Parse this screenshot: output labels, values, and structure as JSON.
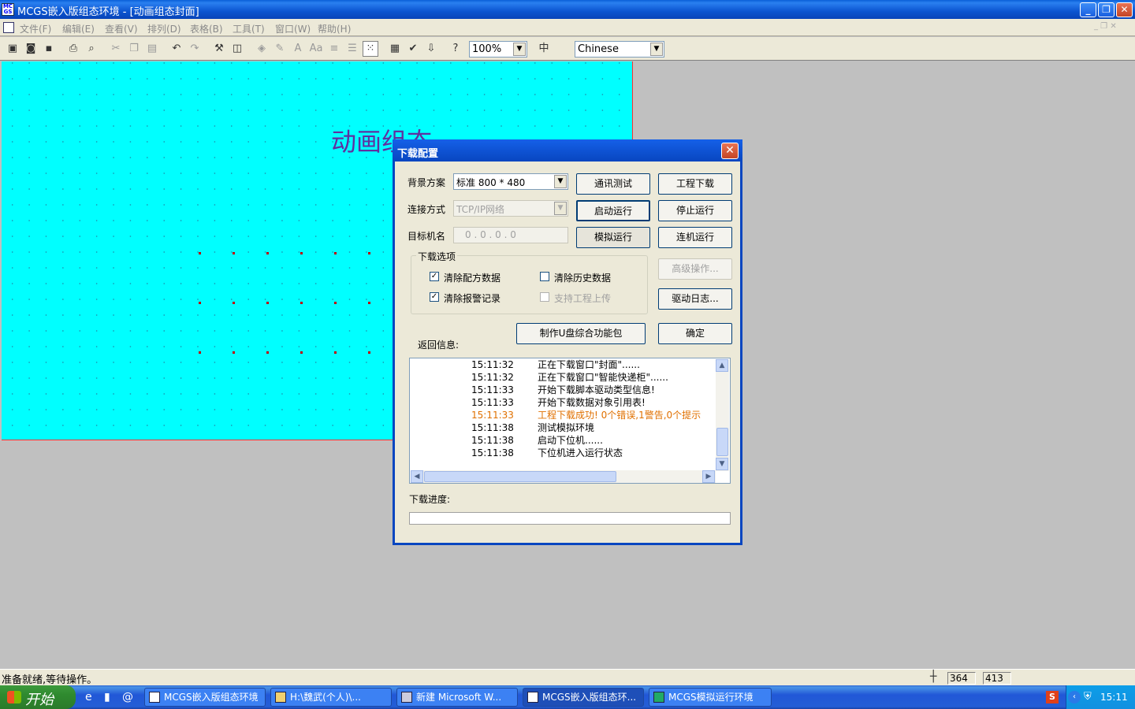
{
  "window": {
    "title": "MCGS嵌入版组态环境 - [动画组态封面]"
  },
  "menu": [
    "文件(F)",
    "编辑(E)",
    "查看(V)",
    "排列(D)",
    "表格(B)",
    "工具(T)",
    "窗口(W)",
    "帮助(H)"
  ],
  "toolbar": {
    "zoom": "100%",
    "language": "Chinese"
  },
  "canvas": {
    "title": "动画组态"
  },
  "dialog": {
    "title": "下载配置",
    "bg_label": "背景方案",
    "bg_value": "标准 800 * 480",
    "conn_label": "连接方式",
    "conn_value": "TCP/IP网络",
    "target_label": "目标机名",
    "target_value": "0 . 0 . 0 . 0",
    "buttons": {
      "comm_test": "通讯测试",
      "project_download": "工程下载",
      "start_run": "启动运行",
      "stop_run": "停止运行",
      "sim_run": "模拟运行",
      "online_run": "连机运行",
      "advanced": "高级操作...",
      "driver_log": "驱动日志...",
      "make_usb": "制作U盘综合功能包",
      "ok": "确定"
    },
    "options": {
      "group_label": "下载选项",
      "clear_recipe": "清除配方数据",
      "clear_history": "清除历史数据",
      "clear_alarm": "清除报警记录",
      "support_upload": "支持工程上传"
    },
    "return_label": "返回信息:",
    "log": [
      {
        "time": "15:11:32",
        "msg": "正在下载窗口\"封面\"......"
      },
      {
        "time": "15:11:32",
        "msg": "正在下载窗口\"智能快递柜\"......"
      },
      {
        "time": "15:11:33",
        "msg": "开始下载脚本驱动类型信息!"
      },
      {
        "time": "15:11:33",
        "msg": "开始下载数据对象引用表!"
      },
      {
        "time": "15:11:33",
        "msg": "工程下载成功! 0个错误,1警告,0个提示"
      },
      {
        "time": "15:11:38",
        "msg": "测试模拟环境"
      },
      {
        "time": "15:11:38",
        "msg": "启动下位机......"
      },
      {
        "time": "15:11:38",
        "msg": "下位机进入运行状态"
      }
    ],
    "progress_label": "下载进度:",
    "progress_value": 0
  },
  "status": {
    "text": "准备就绪,等待操作。",
    "x": "364",
    "y": "413"
  },
  "taskbar": {
    "start": "开始",
    "tasks": [
      "MCGS嵌入版组态环境",
      "H:\\魏武(个人)\\...",
      "新建 Microsoft W...",
      "MCGS嵌入版组态环...",
      "MCGS模拟运行环境"
    ],
    "clock": "15:11"
  },
  "colors": {
    "canvas": "#00ffff",
    "warning": "#e07000",
    "title_bar": "#0846c0"
  }
}
